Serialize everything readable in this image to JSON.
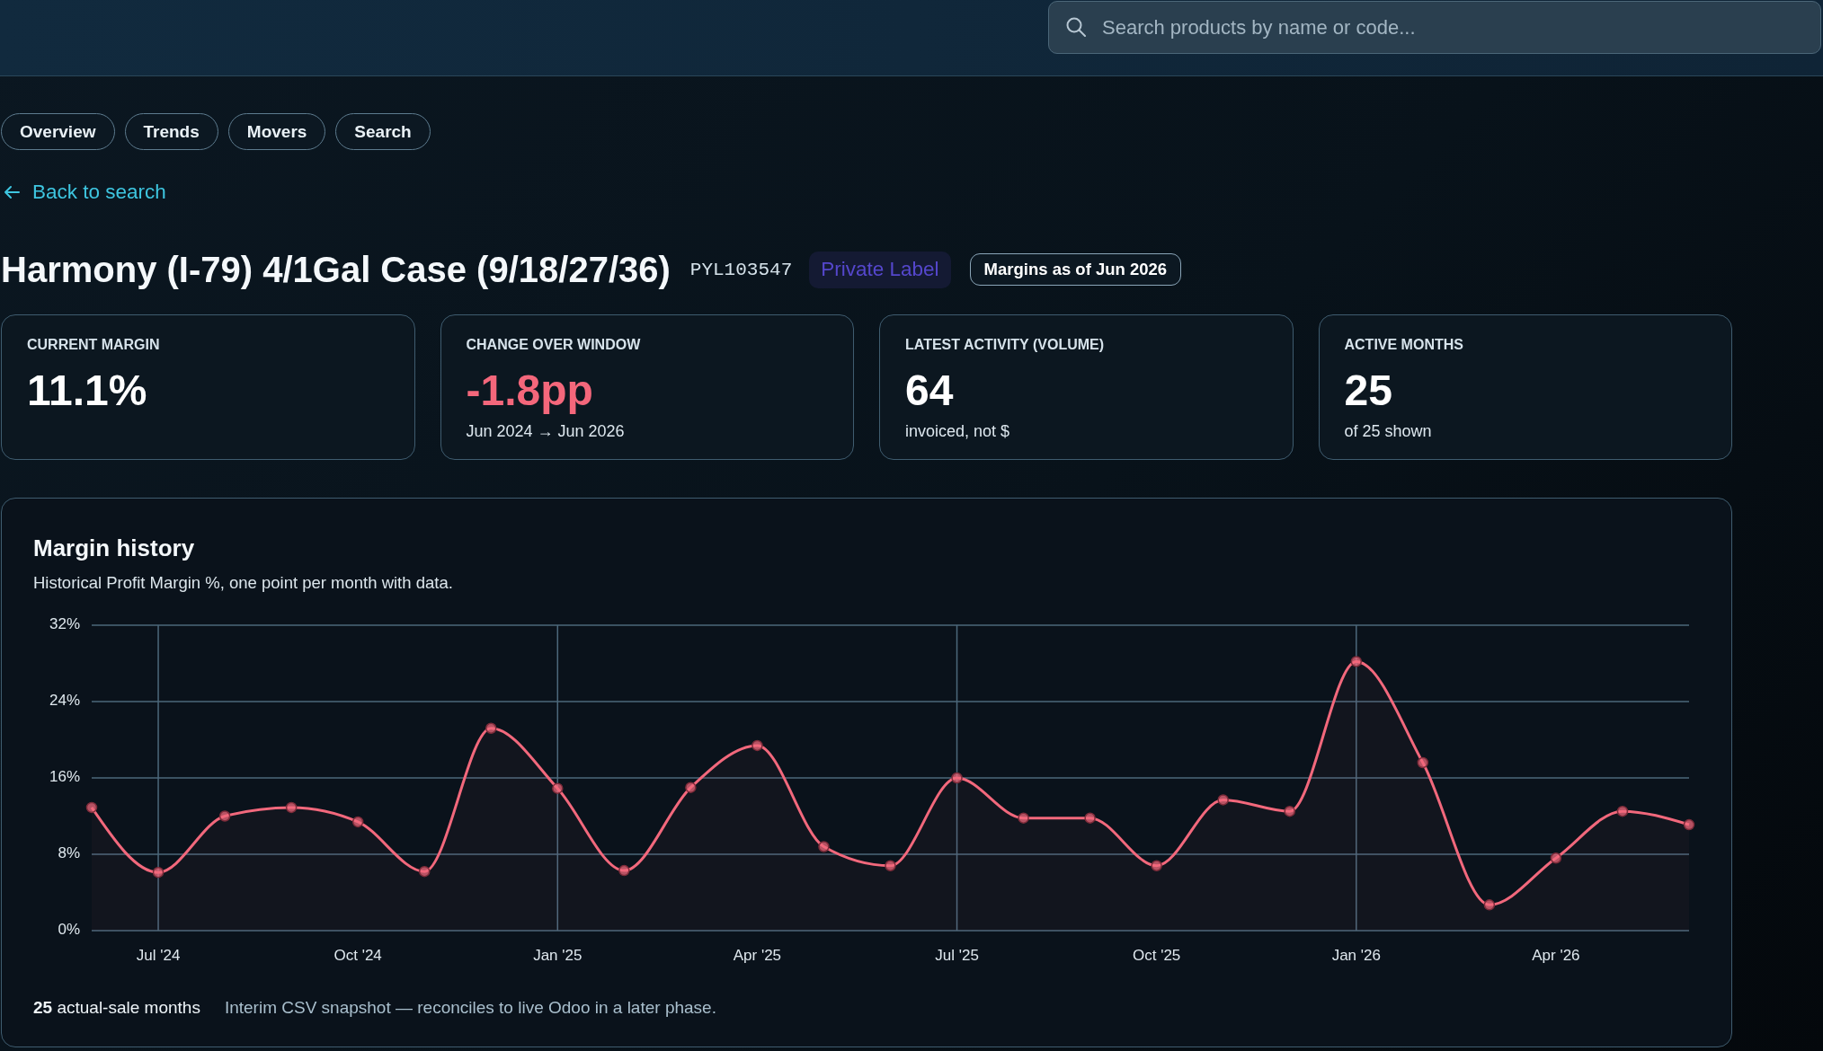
{
  "search": {
    "placeholder": "Search products by name or code..."
  },
  "tabs": [
    {
      "label": "Overview",
      "selected": false
    },
    {
      "label": "Trends",
      "selected": false
    },
    {
      "label": "Movers",
      "selected": false
    },
    {
      "label": "Search",
      "selected": false
    }
  ],
  "back_link": {
    "label": "Back to search"
  },
  "product": {
    "name": "Harmony (I-79) 4/1Gal Case (9/18/27/36)",
    "code": "PYL103547",
    "tag": "Private Label",
    "as_of": "Margins as of Jun 2026"
  },
  "stats": [
    {
      "label": "CURRENT MARGIN",
      "value": "11.1%",
      "negative": false
    },
    {
      "label": "CHANGE OVER WINDOW",
      "value": "-1.8pp",
      "negative": true,
      "note": "Jun 2024 → Jun 2026"
    },
    {
      "label": "LATEST ACTIVITY (VOLUME)",
      "value": "64",
      "negative": false,
      "note": "invoiced, not $"
    },
    {
      "label": "ACTIVE MONTHS",
      "value": "25",
      "negative": false,
      "note": "of 25 shown"
    }
  ],
  "margin_history": {
    "title": "Margin history",
    "subtitle": "Historical Profit Margin %, one point per month with data.",
    "chart_data": {
      "type": "area",
      "categories": [
        null,
        "Jul '24",
        null,
        null,
        "Oct '24",
        null,
        null,
        "Jan '25",
        null,
        null,
        "Apr '25",
        null,
        null,
        "Jul '25",
        null,
        null,
        "Oct '25",
        null,
        null,
        "Jan '26",
        null,
        null,
        "Apr '26",
        null,
        null
      ],
      "series": [
        {
          "color": "#f2687c",
          "values": [
            12.9,
            6.1,
            12.0,
            12.9,
            11.4,
            6.2,
            21.2,
            14.9,
            6.3,
            15.0,
            19.4,
            8.8,
            6.8,
            16.0,
            11.8,
            11.8,
            6.8,
            13.7,
            12.5,
            28.2,
            17.6,
            2.7,
            7.6,
            12.5,
            11.1
          ]
        }
      ],
      "ylim": [
        0,
        32
      ],
      "yticks": [
        {
          "value": 0,
          "label": "0%"
        },
        {
          "value": 8,
          "label": "8%"
        },
        {
          "value": 16,
          "label": "16%"
        },
        {
          "value": 24,
          "label": "24%"
        },
        {
          "value": 32,
          "label": "32%"
        }
      ],
      "grid": true
    },
    "footer": {
      "count": "**25** actual-sale months",
      "note": "Interim CSV snapshot — reconciles to live Odoo in a later phase."
    }
  }
}
